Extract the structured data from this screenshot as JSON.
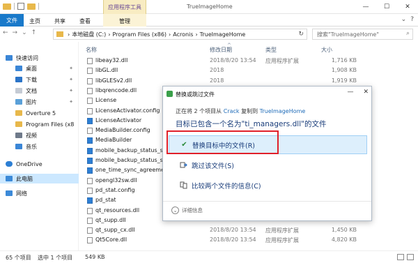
{
  "titlebar": {
    "manage_tab": "应用程序工具",
    "window_title": "TrueImageHome",
    "min": "—",
    "max": "☐",
    "close": "✕"
  },
  "ribbon": {
    "tabs": [
      "文件",
      "主页",
      "共享",
      "查看"
    ],
    "manage": "管理",
    "help": "?"
  },
  "address": {
    "path": [
      "本地磁盘 (C:)",
      "Program Files (x86)",
      "Acronis",
      "TrueImageHome"
    ],
    "search_placeholder": "搜索\"TrueImageHome\""
  },
  "nav": {
    "items": [
      {
        "label": "快速访问",
        "icon": "star-icon",
        "pinned": false
      },
      {
        "label": "桌面",
        "icon": "desktop-icon",
        "pinned": true
      },
      {
        "label": "下载",
        "icon": "download-icon",
        "pinned": true
      },
      {
        "label": "文档",
        "icon": "document-icon",
        "pinned": true
      },
      {
        "label": "图片",
        "icon": "picture-icon",
        "pinned": true
      },
      {
        "label": "Overture 5",
        "icon": "folder-icon",
        "pinned": false
      },
      {
        "label": "Program Files (x8",
        "icon": "folder-icon",
        "pinned": false
      },
      {
        "label": "视频",
        "icon": "video-icon",
        "pinned": false
      },
      {
        "label": "音乐",
        "icon": "music-icon",
        "pinned": false
      },
      {
        "label": "OneDrive",
        "icon": "cloud-icon",
        "pinned": false
      },
      {
        "label": "此电脑",
        "icon": "computer-icon",
        "pinned": false
      },
      {
        "label": "网络",
        "icon": "network-icon",
        "pinned": false
      }
    ]
  },
  "files": {
    "columns": [
      "名称",
      "修改日期",
      "类型",
      "大小"
    ],
    "rows": [
      {
        "name": "libeay32.dll",
        "date": "2018/8/20 13:54",
        "type": "应用程序扩展",
        "size": "1,716 KB"
      },
      {
        "name": "libGL.dll",
        "date": "2018",
        "type": "",
        "size": "1,908 KB"
      },
      {
        "name": "libGLESv2.dll",
        "date": "2018",
        "type": "",
        "size": "1,919 KB"
      },
      {
        "name": "libqrencode.dll",
        "date": "",
        "type": "",
        "size": ""
      },
      {
        "name": "License",
        "date": "",
        "type": "",
        "size": ""
      },
      {
        "name": "LicenseActivator.config",
        "date": "",
        "type": "",
        "size": ""
      },
      {
        "name": "LicenseActivator",
        "date": "",
        "type": "",
        "size": ""
      },
      {
        "name": "MediaBuilder.config",
        "date": "",
        "type": "",
        "size": ""
      },
      {
        "name": "MediaBuilder",
        "date": "",
        "type": "",
        "size": ""
      },
      {
        "name": "mobile_backup_status_se",
        "date": "",
        "type": "",
        "size": ""
      },
      {
        "name": "mobile_backup_status_se",
        "date": "",
        "type": "",
        "size": ""
      },
      {
        "name": "one_time_sync_agreemen",
        "date": "",
        "type": "",
        "size": ""
      },
      {
        "name": "opengl32sw.dll",
        "date": "",
        "type": "",
        "size": ""
      },
      {
        "name": "pd_stat.config",
        "date": "",
        "type": "",
        "size": ""
      },
      {
        "name": "pd_stat",
        "date": "",
        "type": "",
        "size": ""
      },
      {
        "name": "qt_resources.dll",
        "date": "",
        "type": "",
        "size": ""
      },
      {
        "name": "qt_supp.dll",
        "date": "",
        "type": "",
        "size": ""
      },
      {
        "name": "qt_supp_cx.dll",
        "date": "2018/8/20 13:54",
        "type": "应用程序扩展",
        "size": "1,450 KB"
      },
      {
        "name": "Qt5Core.dll",
        "date": "2018/8/20 13:54",
        "type": "应用程序扩展",
        "size": "4,820 KB"
      }
    ]
  },
  "status": {
    "count": "65 个项目",
    "selected": "选中 1 个项目",
    "size": "549 KB"
  },
  "dialog": {
    "title": "替换或跳过文件",
    "subtitle_prefix": "正在将 2 个项目从",
    "source": "Crack",
    "subtitle_mid": "复制到",
    "dest": "TrueImageHome",
    "heading": "目标已包含一个名为\"ti_managers.dll\"的文件",
    "options": [
      {
        "label": "替换目标中的文件(R)",
        "icon": "checkmark-icon",
        "active": true
      },
      {
        "label": "跳过该文件(S)",
        "icon": "skip-icon",
        "active": false
      },
      {
        "label": "比较两个文件的信息(C)",
        "icon": "compare-icon",
        "active": false
      }
    ],
    "more": "详细信息",
    "close": "✕",
    "min": "—"
  },
  "colors": {
    "file_tab": "#1979ca",
    "highlight": "#e0202a",
    "accent_text": "#1a3d7a"
  }
}
